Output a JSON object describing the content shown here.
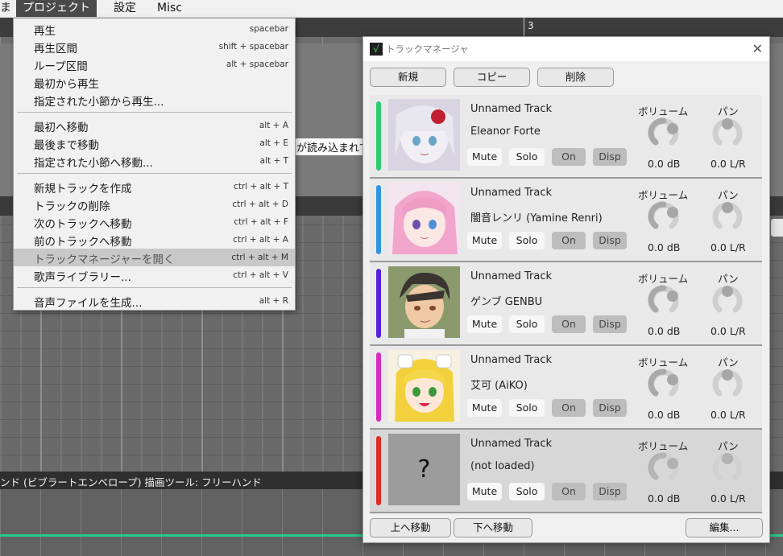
{
  "menubar": {
    "items": [
      {
        "label": "ま"
      },
      {
        "label": "プロジェクト"
      },
      {
        "label": "設定"
      },
      {
        "label": "Misc"
      }
    ]
  },
  "timeline": {
    "measure_label": "3"
  },
  "editor": {
    "loading_text": "が読み込まれて",
    "status_text": "ンド (ビブラートエンベロープ) 描画ツール: フリーハンド"
  },
  "menu": {
    "items": [
      {
        "label": "再生",
        "shortcut": "spacebar"
      },
      {
        "label": "再生区間",
        "shortcut": "shift + spacebar"
      },
      {
        "label": "ループ区間",
        "shortcut": "alt + spacebar"
      },
      {
        "label": "最初から再生",
        "shortcut": ""
      },
      {
        "label": "指定された小節から再生...",
        "shortcut": ""
      },
      {
        "label": "最初へ移動",
        "shortcut": "alt + A"
      },
      {
        "label": "最後まで移動",
        "shortcut": "alt + E"
      },
      {
        "label": "指定された小節へ移動...",
        "shortcut": "alt + T"
      },
      {
        "label": "新規トラックを作成",
        "shortcut": "ctrl + alt + T"
      },
      {
        "label": "トラックの削除",
        "shortcut": "ctrl + alt + D"
      },
      {
        "label": "次のトラックへ移動",
        "shortcut": "ctrl + alt + F"
      },
      {
        "label": "前のトラックへ移動",
        "shortcut": "ctrl + alt + A"
      },
      {
        "label": "トラックマネージャーを開く",
        "shortcut": "ctrl + alt + M"
      },
      {
        "label": "歌声ライブラリー...",
        "shortcut": "ctrl + alt + V"
      },
      {
        "label": "音声ファイルを生成...",
        "shortcut": "alt + R"
      }
    ]
  },
  "dialog": {
    "title": "トラックマネージャ",
    "top_buttons": {
      "new": "新規",
      "copy": "コピー",
      "delete": "削除"
    },
    "bottom_buttons": {
      "up": "上へ移動",
      "down": "下へ移動",
      "edit": "編集..."
    },
    "volume_label": "ボリューム",
    "pan_label": "パン",
    "mute_label": "Mute",
    "solo_label": "Solo",
    "on_label": "On",
    "disp_label": "Disp",
    "placeholder_avatar": "?",
    "tracks": [
      {
        "name": "Unnamed Track",
        "singer": "Eleanor Forte",
        "color": "#2ecc71",
        "volume": "0.0 dB",
        "pan": "0.0 L/R"
      },
      {
        "name": "Unnamed Track",
        "singer": "闇音レンリ (Yamine Renri)",
        "color": "#2f95e0",
        "volume": "0.0 dB",
        "pan": "0.0 L/R"
      },
      {
        "name": "Unnamed Track",
        "singer": "ゲンブ GENBU",
        "color": "#5522dd",
        "volume": "0.0 dB",
        "pan": "0.0 L/R"
      },
      {
        "name": "Unnamed Track",
        "singer": "艾可 (AiKO)",
        "color": "#d92bc0",
        "volume": "0.0 dB",
        "pan": "0.0 L/R"
      },
      {
        "name": "Unnamed Track",
        "singer": "(not loaded)",
        "color": "#dd2c22",
        "volume": "0.0 dB",
        "pan": "0.0 L/R"
      }
    ]
  }
}
